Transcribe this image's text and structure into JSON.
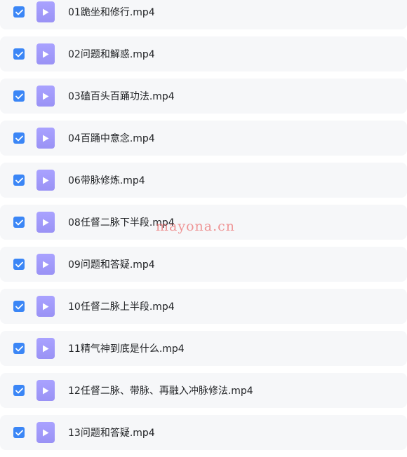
{
  "colors": {
    "checkbox": "#3b86f6",
    "file_icon": "#9f98fb",
    "row_background": "#f6f7f9",
    "watermark": "#eb6e6e"
  },
  "icons": {
    "checkbox": "check-icon",
    "file": "video-play-icon"
  },
  "files": [
    {
      "name": "01跪坐和修行.mp4",
      "checked": true
    },
    {
      "name": "02问题和解惑.mp4",
      "checked": true
    },
    {
      "name": "03磕百头百踊功法.mp4",
      "checked": true
    },
    {
      "name": "04百踊中意念.mp4",
      "checked": true
    },
    {
      "name": "06带脉修炼.mp4",
      "checked": true
    },
    {
      "name": "08任督二脉下半段.mp4",
      "checked": true
    },
    {
      "name": "09问题和答疑.mp4",
      "checked": true
    },
    {
      "name": "10任督二脉上半段.mp4",
      "checked": true
    },
    {
      "name": "11精气神到底是什么.mp4",
      "checked": true
    },
    {
      "name": "12任督二脉、带脉、再融入冲脉修法.mp4",
      "checked": true
    },
    {
      "name": "13问题和答疑.mp4",
      "checked": true
    }
  ],
  "watermark": "mayona.cn"
}
